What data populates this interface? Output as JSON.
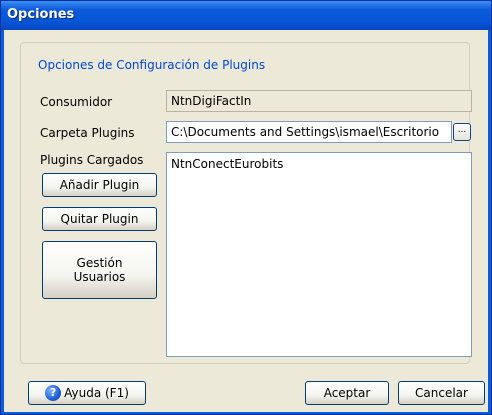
{
  "window": {
    "title": "Opciones"
  },
  "group": {
    "legend": "Opciones de Configuración de Plugins"
  },
  "consumidor": {
    "label": "Consumidor",
    "value": "NtnDigiFactIn"
  },
  "carpeta": {
    "label": "Carpeta Plugins",
    "value": "C:\\Documents and Settings\\ismael\\Escritorio",
    "browse_label": "..."
  },
  "plugins": {
    "label": "Plugins Cargados",
    "add_label": "Añadir Plugin",
    "remove_label": "Quitar Plugin",
    "users_label_line1": "Gestión",
    "users_label_line2": "Usuarios",
    "items": [
      "NtnConectEurobits"
    ]
  },
  "footer": {
    "help_label": "Ayuda (F1)",
    "help_icon": "?",
    "accept_label": "Aceptar",
    "cancel_label": "Cancelar"
  }
}
